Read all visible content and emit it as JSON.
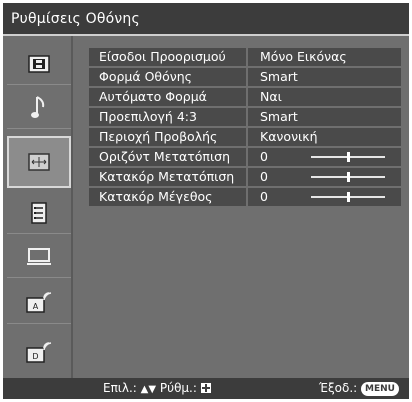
{
  "title": "Ρυθμίσεις Οθόνης",
  "sidebar": {
    "items": [
      {
        "icon": "picture-icon",
        "active": false
      },
      {
        "icon": "sound-note-icon",
        "active": false
      },
      {
        "icon": "screen-settings-icon",
        "active": true
      },
      {
        "icon": "features-list-icon",
        "active": false
      },
      {
        "icon": "pc-monitor-icon",
        "active": false
      },
      {
        "icon": "analog-channel-icon",
        "active": false
      },
      {
        "icon": "digital-channel-icon",
        "active": false
      }
    ]
  },
  "settings": [
    {
      "label": "Είσοδοι Προορισμού",
      "value": "Μόνο Εικόνας"
    },
    {
      "label": "Φορμά Οθόνης",
      "value": "Smart"
    },
    {
      "label": "Αυτόματο Φορμά",
      "value": "Ναι"
    },
    {
      "label": "Προεπιλογή 4:3",
      "value": "Smart"
    },
    {
      "label": "Περιοχή Προβολής",
      "value": "Κανονική"
    },
    {
      "label": "Οριζόντ Μετατόπιση",
      "value": "0",
      "slider": 0.5
    },
    {
      "label": "Κατακόρ Μετατόπιση",
      "value": "0",
      "slider": 0.5
    },
    {
      "label": "Κατακόρ Μέγεθος",
      "value": "0",
      "slider": 0.5
    }
  ],
  "footer": {
    "select_label": "Επιλ.:",
    "adjust_label": "Ρύθμ.:",
    "exit_label": "Έξοδ.:",
    "menu_key": "MENU"
  }
}
